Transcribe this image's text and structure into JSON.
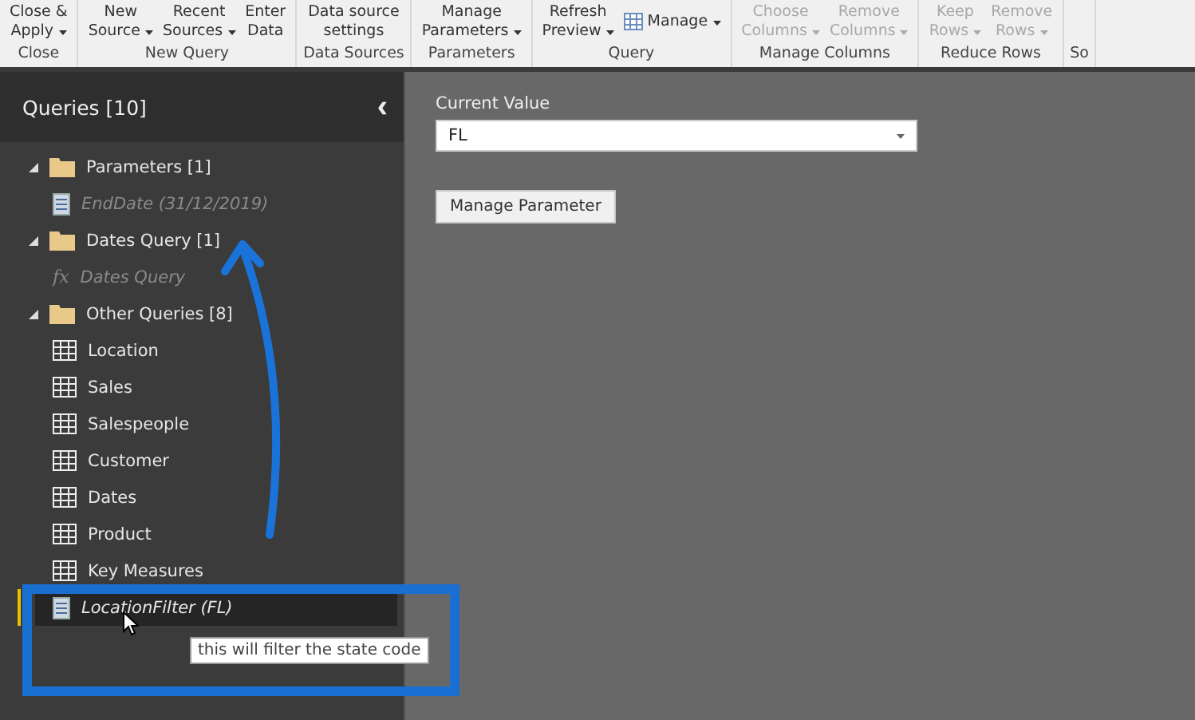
{
  "ribbon": {
    "groups": [
      {
        "label": "Close",
        "buttons": [
          {
            "lines": [
              "Close &",
              "Apply"
            ],
            "dropdown": true,
            "disabled": false
          }
        ]
      },
      {
        "label": "New Query",
        "buttons": [
          {
            "lines": [
              "New",
              "Source"
            ],
            "dropdown": true,
            "disabled": false
          },
          {
            "lines": [
              "Recent",
              "Sources"
            ],
            "dropdown": true,
            "disabled": false
          },
          {
            "lines": [
              "Enter",
              "Data"
            ],
            "dropdown": false,
            "disabled": false
          }
        ]
      },
      {
        "label": "Data Sources",
        "buttons": [
          {
            "lines": [
              "Data source",
              "settings"
            ],
            "dropdown": false,
            "disabled": false
          }
        ]
      },
      {
        "label": "Parameters",
        "buttons": [
          {
            "lines": [
              "Manage",
              "Parameters"
            ],
            "dropdown": true,
            "disabled": false
          }
        ]
      },
      {
        "label": "Query",
        "buttons": [
          {
            "lines": [
              "Refresh",
              "Preview"
            ],
            "dropdown": true,
            "disabled": false
          },
          {
            "lines": [
              "Manage"
            ],
            "dropdown": true,
            "disabled": false,
            "icon": true
          }
        ]
      },
      {
        "label": "Manage Columns",
        "buttons": [
          {
            "lines": [
              "Choose",
              "Columns"
            ],
            "dropdown": true,
            "disabled": true
          },
          {
            "lines": [
              "Remove",
              "Columns"
            ],
            "dropdown": true,
            "disabled": true
          }
        ]
      },
      {
        "label": "Reduce Rows",
        "buttons": [
          {
            "lines": [
              "Keep",
              "Rows"
            ],
            "dropdown": true,
            "disabled": true
          },
          {
            "lines": [
              "Remove",
              "Rows"
            ],
            "dropdown": true,
            "disabled": true
          }
        ]
      },
      {
        "label": "So"
      }
    ]
  },
  "queries_pane": {
    "title": "Queries [10]",
    "collapse_glyph": "‹",
    "groups": [
      {
        "label": "Parameters [1]",
        "expanded": true,
        "children": [
          {
            "label": "EndDate (31/12/2019)",
            "kind": "parameter",
            "loaded": false,
            "selected": false
          }
        ]
      },
      {
        "label": "Dates Query [1]",
        "expanded": true,
        "children": [
          {
            "label": "Dates Query",
            "kind": "function",
            "glyph": "fx",
            "loaded": false,
            "selected": false
          }
        ]
      },
      {
        "label": "Other Queries [8]",
        "expanded": true,
        "children": [
          {
            "label": "Location",
            "kind": "table",
            "loaded": true,
            "selected": false
          },
          {
            "label": "Sales",
            "kind": "table",
            "loaded": true,
            "selected": false
          },
          {
            "label": "Salespeople",
            "kind": "table",
            "loaded": true,
            "selected": false
          },
          {
            "label": "Customer",
            "kind": "table",
            "loaded": true,
            "selected": false
          },
          {
            "label": "Dates",
            "kind": "table",
            "loaded": true,
            "selected": false
          },
          {
            "label": "Product",
            "kind": "table",
            "loaded": true,
            "selected": false
          },
          {
            "label": "Key Measures",
            "kind": "table",
            "loaded": true,
            "selected": false
          },
          {
            "label": "LocationFilter (FL)",
            "kind": "parameter",
            "loaded": false,
            "selected": true
          }
        ]
      }
    ],
    "tooltip": "this will filter the state code"
  },
  "parameter_panel": {
    "label": "Current Value",
    "value": "FL",
    "button": "Manage Parameter"
  }
}
